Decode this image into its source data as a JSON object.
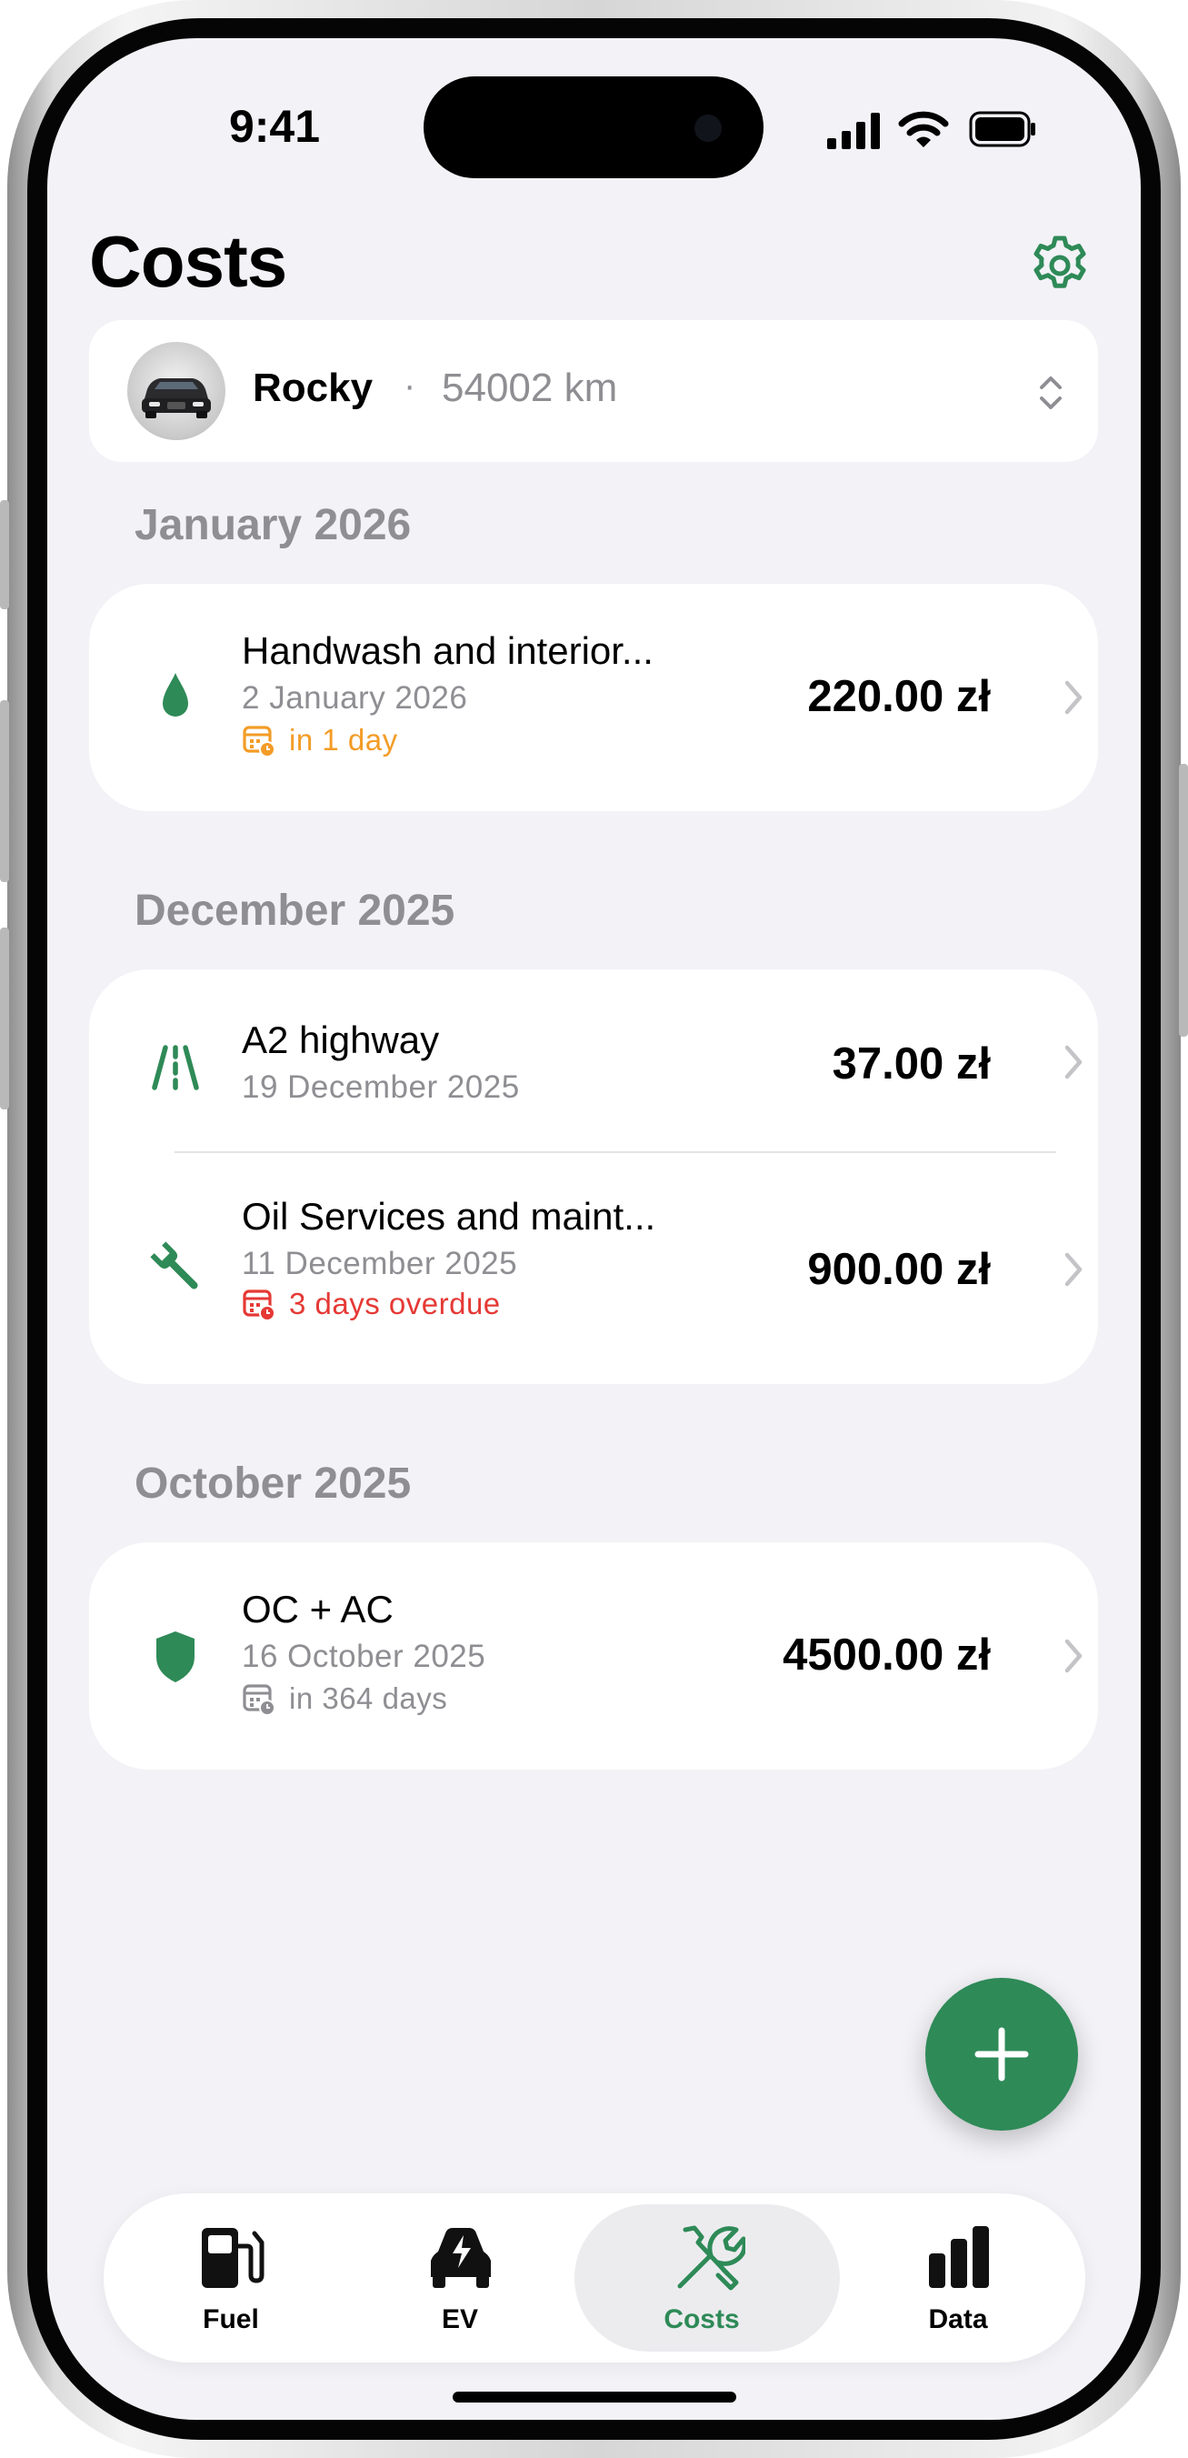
{
  "colors": {
    "accent": "#2e8a57",
    "warning": "#f39c26",
    "overdue": "#e53935",
    "secondary_text": "#8e8e93",
    "background": "#f2f2f7"
  },
  "status_bar": {
    "time": "9:41"
  },
  "header": {
    "title": "Costs",
    "settings_icon": "gear-icon"
  },
  "vehicle": {
    "name": "Rocky",
    "separator": "·",
    "odometer": "54002 km",
    "avatar_icon": "car-photo",
    "chevron_icon": "chevron-up-down-icon"
  },
  "sections": [
    {
      "title": "January 2026",
      "items": [
        {
          "icon": "drop-icon",
          "name": "Handwash and interior...",
          "date": "2 January 2026",
          "due": "in 1 day",
          "due_status": "upcoming",
          "amount": "220.00 zł"
        }
      ]
    },
    {
      "title": "December 2025",
      "items": [
        {
          "icon": "road-icon",
          "name": "A2 highway",
          "date": "19 December 2025",
          "amount": "37.00 zł"
        },
        {
          "icon": "wrench-icon",
          "name": "Oil Services and maint...",
          "date": "11 December 2025",
          "due": "3 days overdue",
          "due_status": "overdue",
          "amount": "900.00 zł"
        }
      ]
    },
    {
      "title": "October 2025",
      "items": [
        {
          "icon": "shield-icon",
          "name": "OC + AC",
          "date": "16 October 2025",
          "due": "in 364 days",
          "due_status": "neutral",
          "amount": "4500.00 zł"
        }
      ]
    }
  ],
  "fab": {
    "icon": "plus-icon"
  },
  "tabs": [
    {
      "label": "Fuel",
      "icon": "fuel-pump-icon",
      "active": false
    },
    {
      "label": "EV",
      "icon": "ev-car-icon",
      "active": false
    },
    {
      "label": "Costs",
      "icon": "tools-icon",
      "active": true
    },
    {
      "label": "Data",
      "icon": "bar-chart-icon",
      "active": false
    }
  ]
}
